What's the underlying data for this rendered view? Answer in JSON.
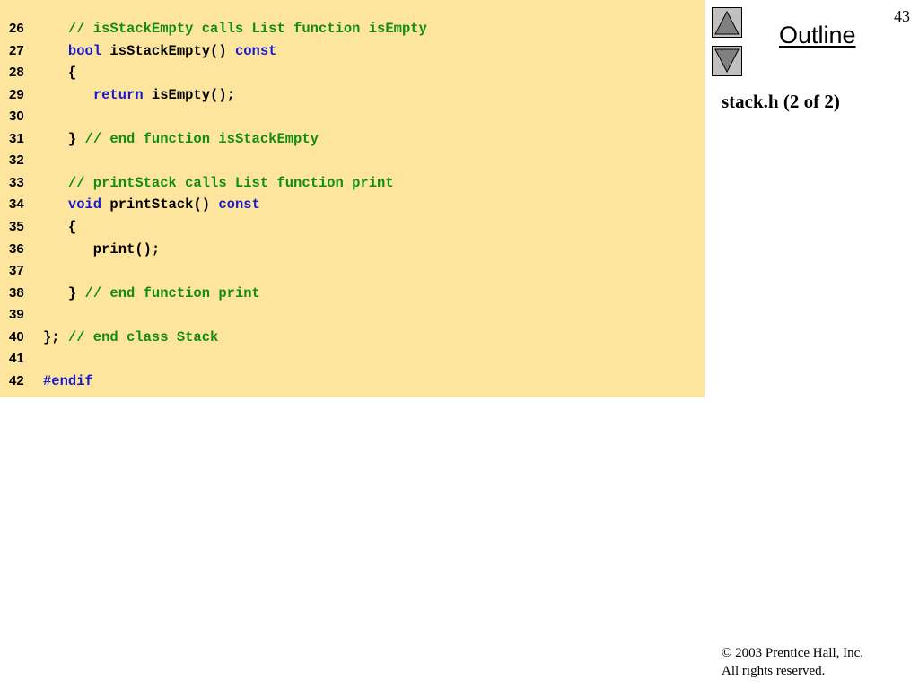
{
  "slide": {
    "page_number": "43",
    "outline_label": "Outline",
    "file_title": "stack.h (2 of 2)",
    "copyright_line1": "© 2003 Prentice Hall, Inc.",
    "copyright_line2": "All rights reserved."
  },
  "navigation": {
    "up_icon": "triangle-up-icon",
    "down_icon": "triangle-down-icon"
  },
  "colors": {
    "code_background": "#fde59e",
    "comment": "#138c13",
    "keyword": "#1a1acd",
    "plain": "#000000"
  },
  "code_lines": [
    {
      "num": "26",
      "tokens": [
        {
          "t": "   "
        },
        {
          "t": "// isStackEmpty calls List function isEmpty",
          "k": "comment"
        }
      ]
    },
    {
      "num": "27",
      "tokens": [
        {
          "t": "   "
        },
        {
          "t": "bool",
          "k": "keyword"
        },
        {
          "t": " isStackEmpty() "
        },
        {
          "t": "const",
          "k": "keyword"
        }
      ]
    },
    {
      "num": "28",
      "tokens": [
        {
          "t": "   {"
        }
      ]
    },
    {
      "num": "29",
      "tokens": [
        {
          "t": "      "
        },
        {
          "t": "return",
          "k": "keyword"
        },
        {
          "t": " isEmpty();"
        }
      ]
    },
    {
      "num": "30",
      "tokens": []
    },
    {
      "num": "31",
      "tokens": [
        {
          "t": "   } "
        },
        {
          "t": "// end function isStackEmpty",
          "k": "comment"
        }
      ]
    },
    {
      "num": "32",
      "tokens": []
    },
    {
      "num": "33",
      "tokens": [
        {
          "t": "   "
        },
        {
          "t": "// printStack calls List function print",
          "k": "comment"
        }
      ]
    },
    {
      "num": "34",
      "tokens": [
        {
          "t": "   "
        },
        {
          "t": "void",
          "k": "keyword"
        },
        {
          "t": " printStack() "
        },
        {
          "t": "const",
          "k": "keyword"
        }
      ]
    },
    {
      "num": "35",
      "tokens": [
        {
          "t": "   {"
        }
      ]
    },
    {
      "num": "36",
      "tokens": [
        {
          "t": "      print();"
        }
      ]
    },
    {
      "num": "37",
      "tokens": []
    },
    {
      "num": "38",
      "tokens": [
        {
          "t": "   } "
        },
        {
          "t": "// end function print",
          "k": "comment"
        }
      ]
    },
    {
      "num": "39",
      "tokens": []
    },
    {
      "num": "40",
      "tokens": [
        {
          "t": "}; "
        },
        {
          "t": "// end class Stack",
          "k": "comment"
        }
      ]
    },
    {
      "num": "41",
      "tokens": []
    },
    {
      "num": "42",
      "tokens": [
        {
          "t": "#endif",
          "k": "preproc"
        }
      ]
    }
  ]
}
